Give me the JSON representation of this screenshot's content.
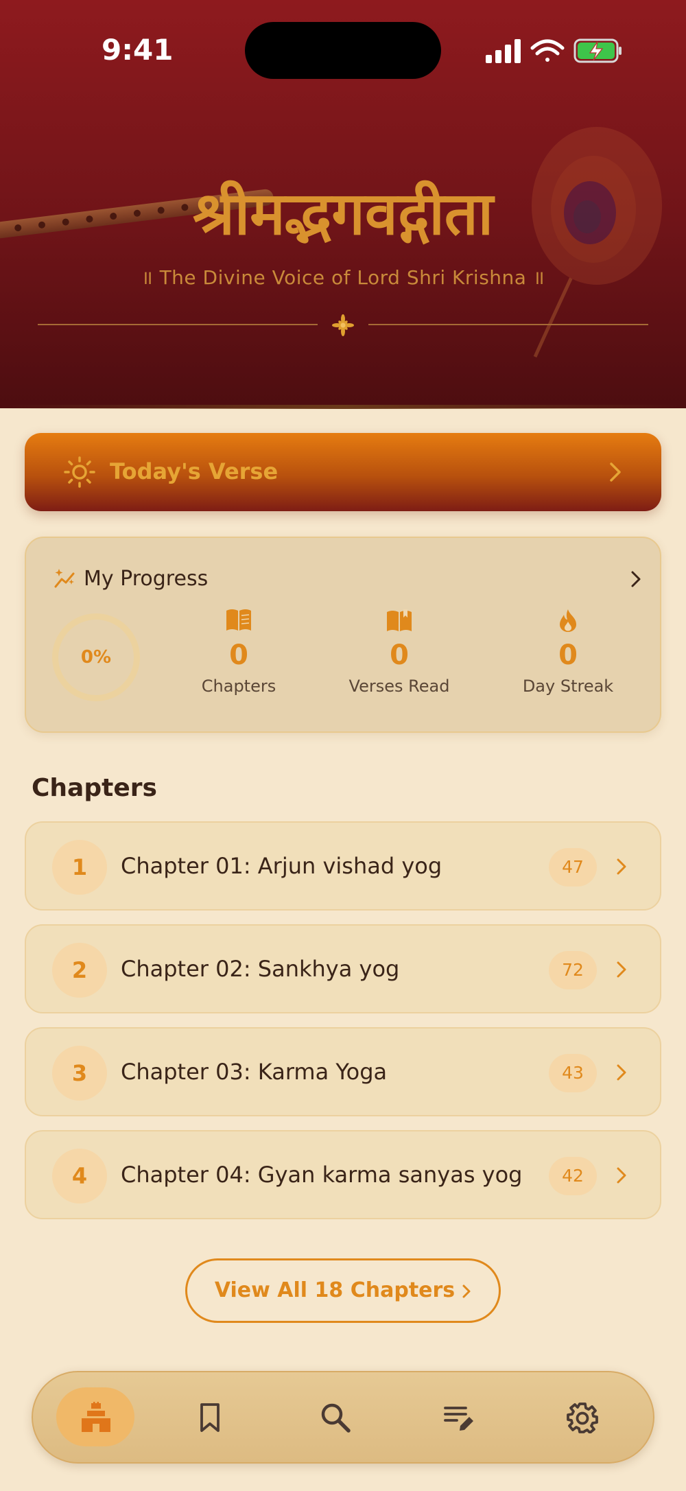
{
  "status_bar": {
    "time": "9:41"
  },
  "header": {
    "title": "श्रीमद्भगवद्गीता",
    "subtitle": "॥ The Divine Voice of Lord Shri Krishna ॥"
  },
  "today_verse": {
    "label": "Today's Verse",
    "icon": "sun-icon"
  },
  "progress": {
    "title": "My Progress",
    "percent_text": "0%",
    "percent_value": 0,
    "stats": [
      {
        "value": "0",
        "label": "Chapters",
        "icon": "book-icon"
      },
      {
        "value": "0",
        "label": "Verses Read",
        "icon": "open-book-icon"
      },
      {
        "value": "0",
        "label": "Day Streak",
        "icon": "flame-icon"
      }
    ]
  },
  "chapters": {
    "heading": "Chapters",
    "items": [
      {
        "number": "1",
        "title": "Chapter 01: Arjun vishad yog",
        "verses": "47"
      },
      {
        "number": "2",
        "title": "Chapter 02: Sankhya yog",
        "verses": "72"
      },
      {
        "number": "3",
        "title": "Chapter 03: Karma Yoga",
        "verses": "43"
      },
      {
        "number": "4",
        "title": "Chapter 04: Gyan karma sanyas yog",
        "verses": "42"
      }
    ],
    "view_all_label": "View All 18 Chapters"
  },
  "bottom_nav": {
    "items": [
      {
        "icon": "temple-icon",
        "active": true
      },
      {
        "icon": "bookmark-icon",
        "active": false
      },
      {
        "icon": "search-icon",
        "active": false
      },
      {
        "icon": "notes-edit-icon",
        "active": false
      },
      {
        "icon": "gear-icon",
        "active": false
      }
    ]
  },
  "colors": {
    "header_red": "#8e1a1e",
    "accent_orange": "#e0891c",
    "gold": "#d9922e",
    "background": "#f6e7cd"
  }
}
